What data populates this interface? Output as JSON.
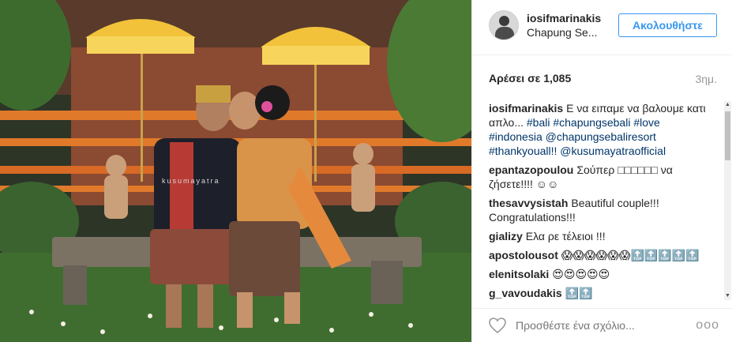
{
  "post": {
    "image_alt": "Wedding couple in traditional Balinese attire kissing on a stone bench under yellow ceremonial umbrellas",
    "image_watermark": "kusumayatra"
  },
  "header": {
    "username": "iosifmarinakis",
    "location": "Chapung Se...",
    "follow_label": "Ακολουθήστε"
  },
  "stats": {
    "likes_label": "Αρέσει σε 1,085",
    "time_ago": "3ημ."
  },
  "caption": {
    "user": "iosifmarinakis",
    "text": "Ε να ειπαμε να βαλουμε κατι απλο...",
    "hashtags": "#bali #chapungsebali #love #indonesia @chapungsebaliresort #thankyouall!! @kusumayatraofficial"
  },
  "comments": [
    {
      "user": "epantazopoulou",
      "text": "Σούπερ □□□□□□ να ζήσετε!!!! ☺☺"
    },
    {
      "user": "thesavvysistah",
      "text": "Beautiful couple!!! Congratulations!!!"
    },
    {
      "user": "gializy",
      "text": "Ελα ρε τέλειοι !!!"
    },
    {
      "user": "apostolousot",
      "text": "😱😱😱😱😱😱🔝🔝🔝🔝🔝"
    },
    {
      "user": "elenitsolaki",
      "text": "😍😍😍😍😍"
    },
    {
      "user": "g_vavoudakis",
      "text": "🔝🔝"
    }
  ],
  "footer": {
    "comment_placeholder": "Προσθέστε ένα σχόλιο...",
    "more_label": "ooo"
  },
  "colors": {
    "accent": "#3897f0",
    "link": "#003569",
    "muted": "#999999",
    "umbrella": "#f2c23a"
  }
}
